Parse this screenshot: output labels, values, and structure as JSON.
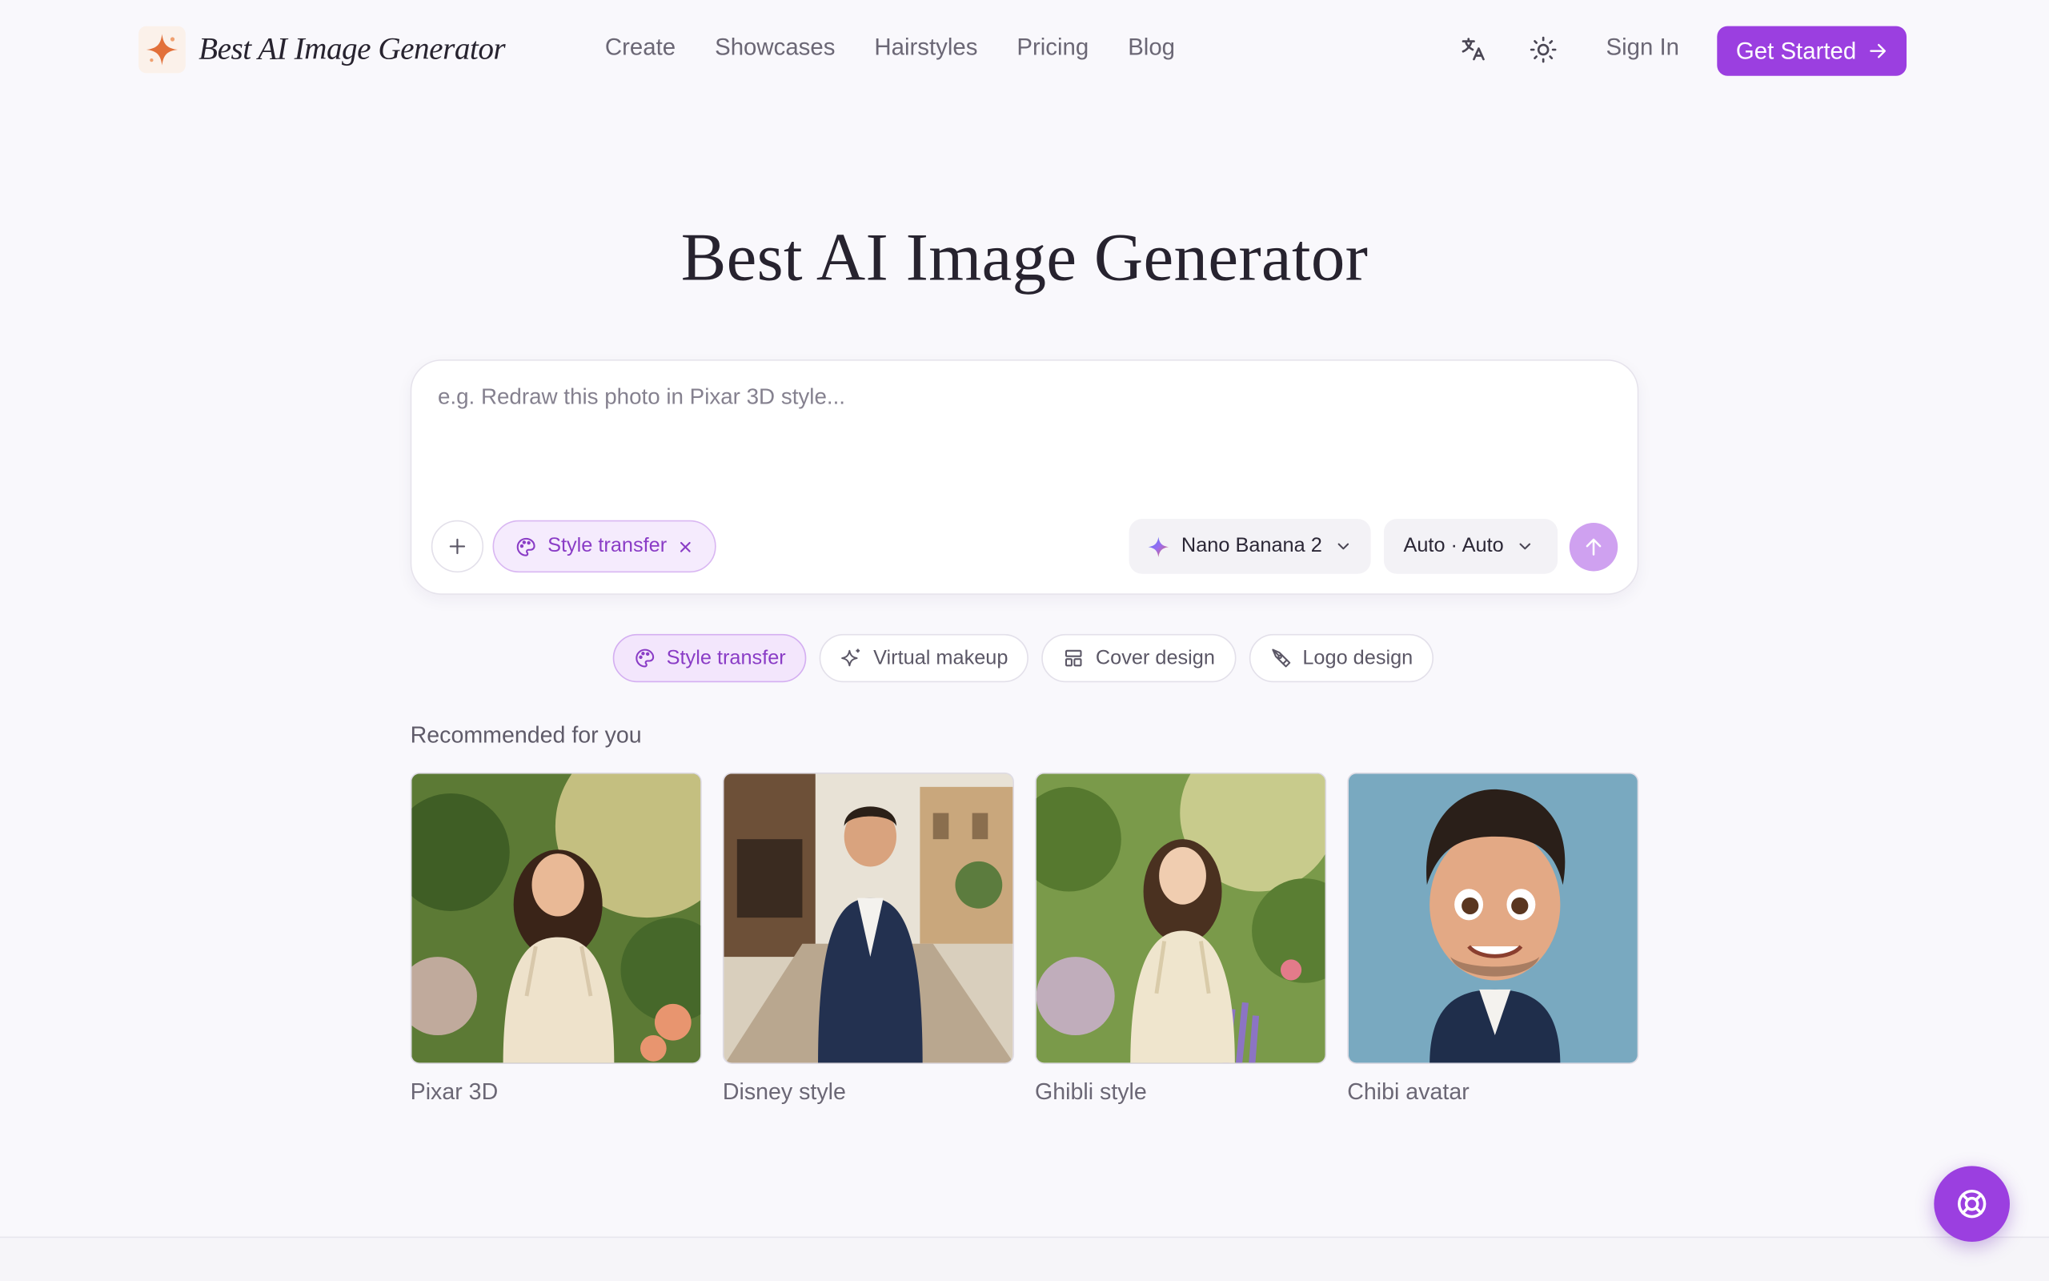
{
  "brand": {
    "name": "Best AI Image Generator"
  },
  "nav": [
    "Create",
    "Showcases",
    "Hairstyles",
    "Pricing",
    "Blog"
  ],
  "header": {
    "sign_in": "Sign In",
    "cta": "Get Started"
  },
  "hero": {
    "title": "Best AI Image Generator"
  },
  "prompt": {
    "placeholder": "e.g. Redraw this photo in Pixar 3D style...",
    "active_tool": "Style transfer",
    "model": "Nano Banana 2",
    "ratio": "Auto · Auto"
  },
  "tools": [
    "Style transfer",
    "Virtual makeup",
    "Cover design",
    "Logo design"
  ],
  "recommended": {
    "title": "Recommended for you",
    "items": [
      "Pixar 3D",
      "Disney style",
      "Ghibli style",
      "Chibi avatar"
    ]
  },
  "colors": {
    "accent": "#9b3fe0",
    "background": "#f9f8fc"
  }
}
